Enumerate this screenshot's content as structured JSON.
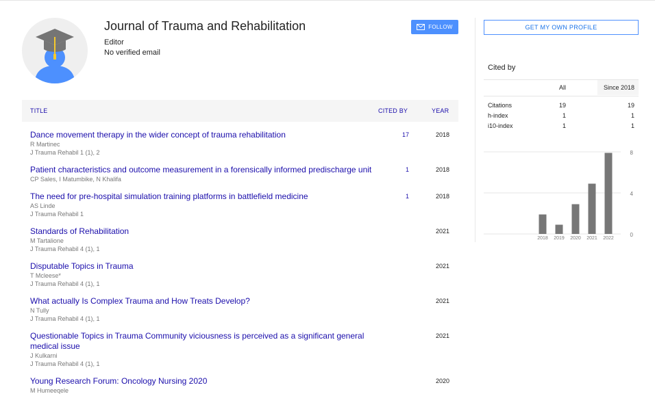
{
  "colors": {
    "link": "#1a0dab",
    "accent": "#4d90fe",
    "muted": "#777777",
    "bar": "#777777",
    "avatar_bg": "#efefef",
    "avatar_person": "#4d90fe",
    "cap": "#757575",
    "tassel": "#f6c92c"
  },
  "profile": {
    "name": "Journal of Trauma and Rehabilitation",
    "affiliation": "Editor",
    "email_status": "No verified email",
    "follow_label": "FOLLOW",
    "avatar_icon": "graduation-cap-person-icon",
    "follow_icon": "mail-icon"
  },
  "table": {
    "headers": {
      "title": "TITLE",
      "cited_by": "CITED BY",
      "year": "YEAR"
    },
    "rows": [
      {
        "title": "Dance movement therapy in the wider concept of trauma rehabilitation",
        "authors": "R Martinec",
        "venue": "J Trauma Rehabil 1 (1), 2",
        "cited_by": "17",
        "year": "2018"
      },
      {
        "title": "Patient characteristics and outcome measurement in a forensically informed predischarge unit",
        "authors": "CP Sales, I Matumbike, N Khalifa",
        "venue": "",
        "cited_by": "1",
        "year": "2018"
      },
      {
        "title": "The need for pre-hospital simulation training platforms in battlefield medicine",
        "authors": "AS Linde",
        "venue": "J Trauma Rehabil 1",
        "cited_by": "1",
        "year": "2018"
      },
      {
        "title": "Standards of Rehabilitation",
        "authors": "M Tartalione",
        "venue": "J Trauma Rehabil 4 (1), 1",
        "cited_by": "",
        "year": "2021"
      },
      {
        "title": "Disputable Topics in Trauma",
        "authors": "T Mcleese*",
        "venue": "J Trauma Rehabil 4 (1), 1",
        "cited_by": "",
        "year": "2021"
      },
      {
        "title": "What actually Is Complex Trauma and How Treats Develop?",
        "authors": "N Tully",
        "venue": "J Trauma Rehabil 4 (1), 1",
        "cited_by": "",
        "year": "2021"
      },
      {
        "title": "Questionable Topics in Trauma Community viciousness is perceived as a significant general medical issue",
        "authors": "J Kulkarni",
        "venue": "J Trauma Rehabil 4 (1), 1",
        "cited_by": "",
        "year": "2021"
      },
      {
        "title": "Young Research Forum: Oncology Nursing 2020",
        "authors": "M Humeeqele",
        "venue": "",
        "cited_by": "",
        "year": "2020"
      }
    ]
  },
  "sidebar": {
    "get_profile_label": "GET MY OWN PROFILE",
    "cited_by_heading": "Cited by",
    "metrics_headers": {
      "all": "All",
      "since": "Since 2018"
    },
    "metrics": [
      {
        "label": "Citations",
        "all": "19",
        "since": "19"
      },
      {
        "label": "h-index",
        "all": "1",
        "since": "1"
      },
      {
        "label": "i10-index",
        "all": "1",
        "since": "1"
      }
    ]
  },
  "chart_data": {
    "type": "bar",
    "categories": [
      "2018",
      "2019",
      "2020",
      "2021",
      "2022"
    ],
    "values": [
      1.9,
      0.9,
      2.9,
      4.9,
      7.9
    ],
    "ylim": [
      0,
      8
    ],
    "yticks": [
      "0",
      "4",
      "8"
    ],
    "grid": true,
    "title": "",
    "xlabel": "",
    "ylabel": ""
  }
}
